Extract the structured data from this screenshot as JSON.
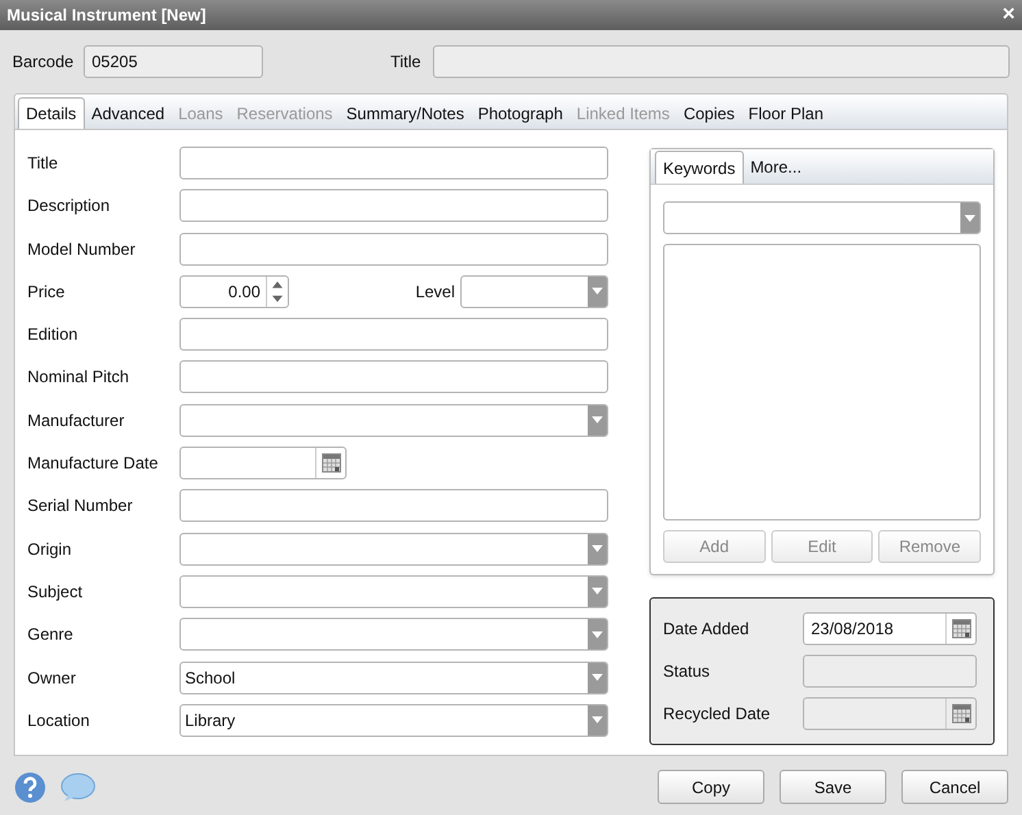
{
  "window": {
    "title": "Musical Instrument [New]",
    "close": "×"
  },
  "header": [
    {
      "label": "Barcode",
      "value": "05205",
      "disabled": true
    },
    {
      "label": "Title",
      "disabled": true
    }
  ],
  "tabs": [
    {
      "label": "Details",
      "selected": true,
      "disabled": false
    },
    {
      "label": "Advanced",
      "selected": false,
      "disabled": false
    },
    {
      "label": "Loans",
      "selected": false,
      "disabled": true
    },
    {
      "label": "Reservations",
      "selected": false,
      "disabled": true
    },
    {
      "label": "Summary/Notes",
      "selected": false,
      "disabled": false
    },
    {
      "label": "Photograph",
      "selected": false,
      "disabled": false
    },
    {
      "label": "Linked Items",
      "selected": false,
      "disabled": true
    },
    {
      "label": "Copies",
      "selected": false,
      "disabled": false
    },
    {
      "label": "Floor Plan",
      "selected": false,
      "disabled": false
    }
  ],
  "fields": [
    {
      "label": "Title",
      "kind": "text"
    },
    {
      "label": "Description",
      "kind": "text"
    },
    {
      "label": "Model Number",
      "kind": "text"
    },
    {
      "label": "Price",
      "kind": "spin",
      "value": "0.00",
      "side": {
        "label": "Level",
        "kind": "dropdown"
      }
    },
    {
      "label": "Edition",
      "kind": "text"
    },
    {
      "label": "Nominal Pitch",
      "kind": "text"
    },
    {
      "label": "Manufacturer",
      "kind": "dropdown"
    },
    {
      "label": "Manufacture Date",
      "kind": "date"
    },
    {
      "label": "Serial Number",
      "kind": "text"
    },
    {
      "label": "Origin",
      "kind": "dropdown"
    },
    {
      "label": "Subject",
      "kind": "dropdown"
    },
    {
      "label": "Genre",
      "kind": "dropdown"
    },
    {
      "label": "Owner",
      "kind": "dropdown",
      "value": "School"
    },
    {
      "label": "Location",
      "kind": "dropdown",
      "value": "Library"
    }
  ],
  "keywords": {
    "tabs": [
      {
        "label": "Keywords",
        "selected": true
      },
      {
        "label": "More...",
        "selected": false
      }
    ],
    "buttons": [
      {
        "label": "Add",
        "disabled": true
      },
      {
        "label": "Edit",
        "disabled": true
      },
      {
        "label": "Remove",
        "disabled": true
      }
    ]
  },
  "dates": [
    {
      "label": "Date Added",
      "kind": "date",
      "value": "23/08/2018",
      "disabled": false
    },
    {
      "label": "Status",
      "kind": "text",
      "disabled": true
    },
    {
      "label": "Recycled Date",
      "kind": "date",
      "disabled": true
    }
  ],
  "buttons": [
    "Copy",
    "Save",
    "Cancel"
  ]
}
